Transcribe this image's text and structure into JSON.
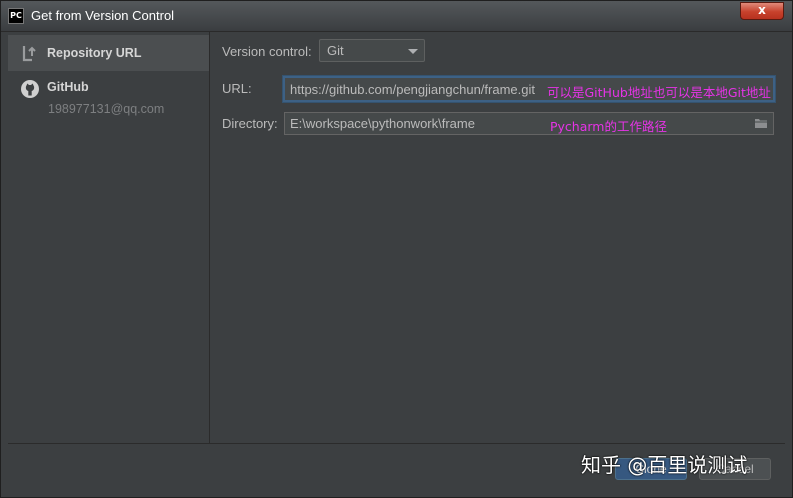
{
  "window": {
    "title": "Get from Version Control",
    "app_icon_text": "PC",
    "close_symbol": "x"
  },
  "sidebar": {
    "items": [
      {
        "label": "Repository URL",
        "icon": "repository-url-icon",
        "selected": true
      },
      {
        "label": "GitHub",
        "sublabel": "198977131@qq.com",
        "icon": "github-icon",
        "selected": false
      }
    ]
  },
  "form": {
    "vcs": {
      "label": "Version control:",
      "value": "Git"
    },
    "url": {
      "label": "URL:",
      "value": "https://github.com/pengjiangchun/frame.git",
      "annotation": "可以是GitHub地址也可以是本地Git地址"
    },
    "directory": {
      "label": "Directory:",
      "value": "E:\\workspace\\pythonwork\\frame",
      "annotation": "Pycharm的工作路径"
    }
  },
  "buttons": {
    "primary_label": "Clone",
    "secondary_label": "Cancel"
  },
  "watermark": "知乎 @百里说测试",
  "colors": {
    "background": "#3c3f41",
    "selected": "#4b4e50",
    "annotation": "#e633e6",
    "focus_border": "#3d6185"
  }
}
